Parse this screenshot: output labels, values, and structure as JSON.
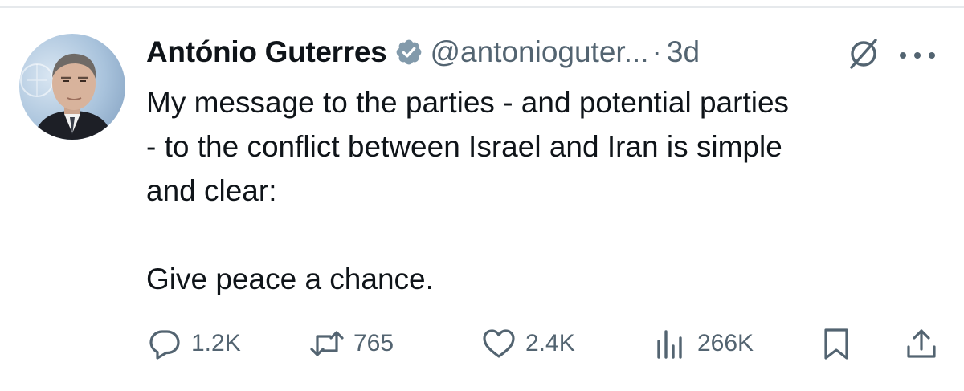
{
  "tweet": {
    "author": {
      "display_name": "António Guterres",
      "handle": "@antonioguter...",
      "verified": true,
      "verified_color": "#829aab"
    },
    "separator": "·",
    "time": "3d",
    "text": "My message to the parties - and potential parties\n- to the conflict between Israel and Iran is simple\nand clear:\n\nGive peace a chance.",
    "metrics": {
      "replies": "1.2K",
      "reposts": "765",
      "likes": "2.4K",
      "views": "266K"
    }
  },
  "icons": [
    "grok-icon",
    "more-icon",
    "reply-icon",
    "repost-icon",
    "like-icon",
    "views-icon",
    "bookmark-icon",
    "share-icon"
  ],
  "colors": {
    "text": "#0f1419",
    "muted": "#536471",
    "divider": "#e6e9ec"
  }
}
